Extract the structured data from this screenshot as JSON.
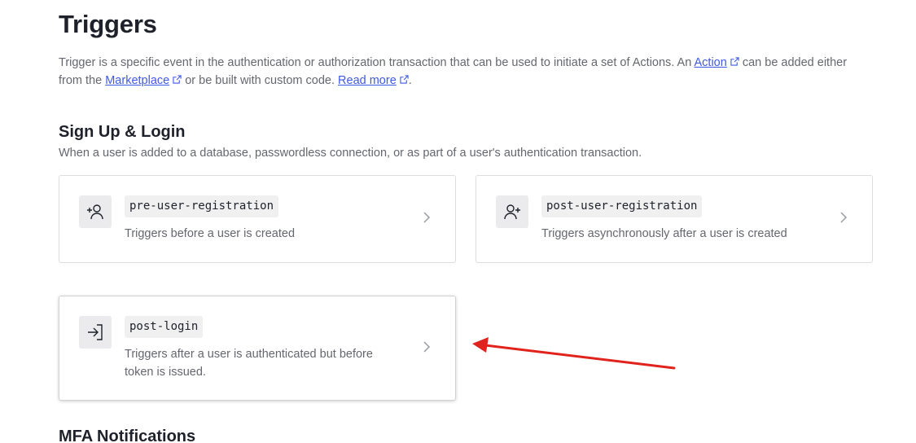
{
  "page": {
    "title": "Triggers",
    "intro": {
      "part1": "Trigger is a specific event in the authentication or authorization transaction that can be used to initiate a set of Actions. An ",
      "action_link": "Action",
      "part2": " can be added either from the ",
      "marketplace_link": "Marketplace",
      "part3": " or be built with custom code. ",
      "read_more_link": "Read more",
      "part4": "."
    }
  },
  "sections": {
    "signup_login": {
      "title": "Sign Up & Login",
      "description": "When a user is added to a database, passwordless connection, or as part of a user's authentication transaction."
    },
    "mfa": {
      "title": "MFA Notifications"
    }
  },
  "triggers": [
    {
      "name": "pre-user-registration",
      "description": "Triggers before a user is created",
      "icon": "user-add-icon"
    },
    {
      "name": "post-user-registration",
      "description": "Triggers asynchronously after a user is created",
      "icon": "user-added-icon"
    },
    {
      "name": "post-login",
      "description": "Triggers after a user is authenticated but before token is issued.",
      "icon": "login-icon"
    }
  ],
  "colors": {
    "link": "#3f59e4",
    "annotation_arrow": "#e0231c",
    "muted_text": "#65676e"
  }
}
